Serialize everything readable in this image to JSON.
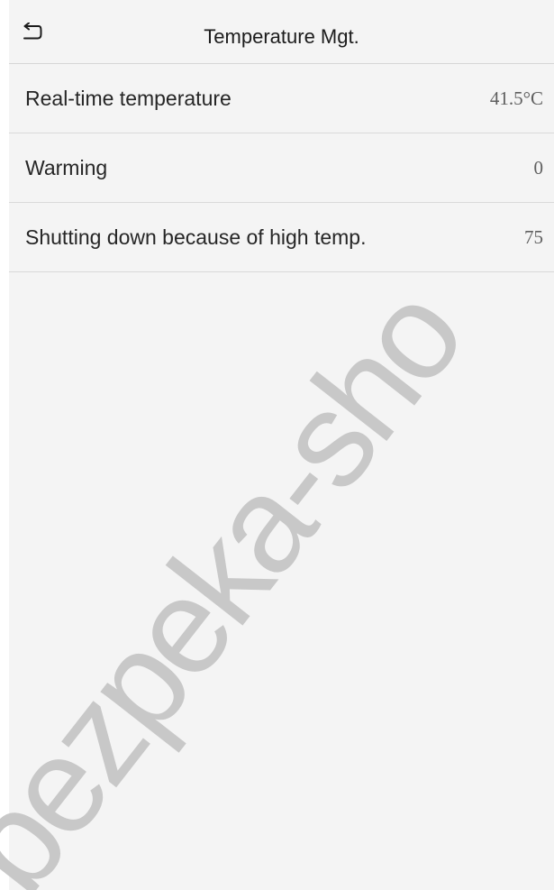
{
  "header": {
    "back_icon": "back-arrow-icon",
    "title": "Temperature Mgt."
  },
  "settings": [
    {
      "label": "Real-time temperature",
      "value": "41.5°C"
    },
    {
      "label": "Warming",
      "value": "0"
    },
    {
      "label": "Shutting down because of high temp.",
      "value": "75"
    }
  ],
  "watermark": {
    "text": "bezpeka-sho",
    "color": "#c8c8c8"
  },
  "colors": {
    "background": "#f4f4f4",
    "divider": "#d9d9d9",
    "text": "#262626",
    "value_text": "#5f5f5f"
  }
}
